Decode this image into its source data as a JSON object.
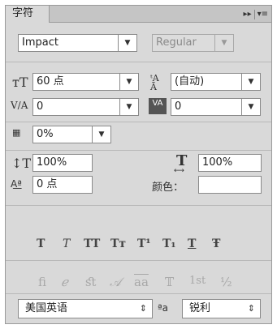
{
  "panel": {
    "tab_label": "字符"
  },
  "titlebar": {
    "collapse_glyph": "▸▸",
    "menu_glyph": "▾≡"
  },
  "font": {
    "family": "Impact",
    "style": "Regular"
  },
  "size": {
    "value": "60 点",
    "leading": "(自动)"
  },
  "kerning": {
    "value": "0",
    "tracking": "0"
  },
  "tsume": {
    "value": "0%"
  },
  "scale": {
    "vertical": "100%",
    "horizontal": "100%"
  },
  "baseline_shift": {
    "value": "0 点"
  },
  "color": {
    "label": "颜色："
  },
  "styles": [
    "T",
    "T",
    "TT",
    "Tт",
    "T¹",
    "T₁",
    "T",
    "Ŧ"
  ],
  "opentype": [
    "ﬁ",
    "ℯ",
    "ﬆ",
    "𝒜",
    "aa",
    "𝕋",
    "1st",
    "½"
  ],
  "language": {
    "value": "美国英语",
    "aa_label": "ªa",
    "antialias": "锐利"
  },
  "accent_colors": {
    "panel_bg": "#d9d9d9",
    "field_bg": "#ffffff",
    "disabled": "#a8a8a8"
  }
}
